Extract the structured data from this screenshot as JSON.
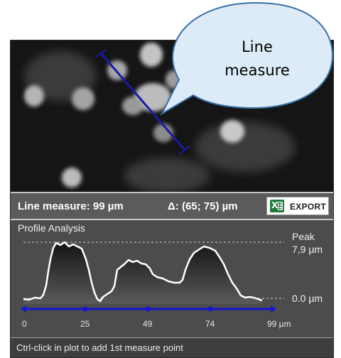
{
  "measure_bar": {
    "measurement": "Line measure: 99 µm",
    "delta": "Δ: (65; 75) µm",
    "export_label": "EXPORT"
  },
  "profile": {
    "title": "Profile Analysis",
    "peak_label": "Peak",
    "peak_value": "7,9 µm",
    "baseline_label": "0.0 µm",
    "axis_ticks": [
      "0",
      "25",
      "49",
      "74",
      "99 µm"
    ]
  },
  "status": {
    "hint": "Ctrl-click in plot to add 1st measure point"
  },
  "callout": {
    "line1": "Line",
    "line2": "measure"
  },
  "colors": {
    "measure_line": "#1a1aa8",
    "scale_line": "#1515d6",
    "excel_green": "#1f7a3a"
  },
  "icons": [
    "excel-icon"
  ]
}
